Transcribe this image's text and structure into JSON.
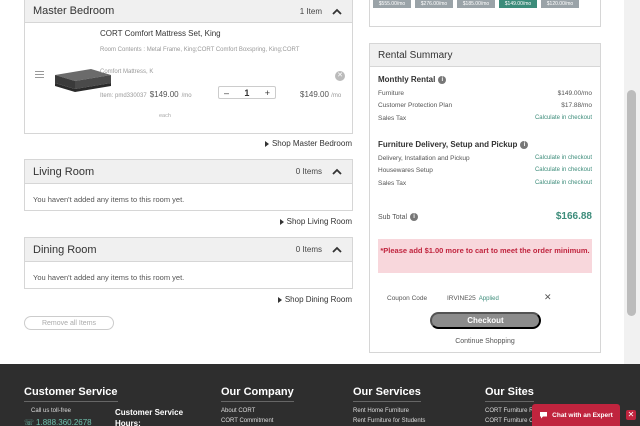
{
  "rooms": [
    {
      "title": "Master Bedroom",
      "count": "1 Item",
      "shop_link": "Shop Master Bedroom",
      "product": {
        "name": "CORT Comfort Mattress Set, King",
        "contents": "Room Contents : Metal Frame, King;CORT Comfort Boxspring, King;CORT",
        "subtitle": "Comfort Mattress, K",
        "item_id": "Item: pmd330037",
        "price": "$149.00",
        "price_unit": "/mo",
        "quantity": "1",
        "total": "$149.00",
        "total_unit": "/mo",
        "each": "each"
      }
    },
    {
      "title": "Living Room",
      "count": "0 Items",
      "empty_message": "You haven't added any items to this room yet.",
      "shop_link": "Shop Living Room"
    },
    {
      "title": "Dining Room",
      "count": "0 Items",
      "empty_message": "You haven't added any items to this room yet.",
      "shop_link": "Shop Dining Room"
    }
  ],
  "remove_all_label": "Remove all Items",
  "price_tiles": [
    "$555.00/mo",
    "$276.00/mo",
    "$185.00/mo",
    "$149.00/mo",
    "$120.00/mo"
  ],
  "summary": {
    "title": "Rental Summary",
    "monthly": {
      "title": "Monthly Rental",
      "rows": [
        {
          "label": "Furniture",
          "value": "$149.00/mo"
        },
        {
          "label": "Customer Protection Plan",
          "value": "$17.88/mo"
        },
        {
          "label": "Sales Tax",
          "value": "Calculate in checkout"
        }
      ]
    },
    "delivery": {
      "title": "Furniture Delivery, Setup and Pickup",
      "rows": [
        {
          "label": "Delivery, Installation and Pickup",
          "value": "Calculate in checkout"
        },
        {
          "label": "Housewares Setup",
          "value": "Calculate in checkout"
        },
        {
          "label": "Sales Tax",
          "value": "Calculate in checkout"
        }
      ]
    },
    "subtotal_label": "Sub Total",
    "subtotal_value": "$166.88",
    "alert": "*Please add $1.00 more to cart to meet the order minimum.",
    "coupon_label": "Coupon Code",
    "coupon_code": "IRVINE25",
    "coupon_status": "Applied",
    "checkout_label": "Checkout",
    "continue_label": "Continue Shopping"
  },
  "footer": {
    "customer_service": "Customer Service",
    "call_label": "Call us toll-free",
    "phone": "1.888.360.2678",
    "cs_hours": "Customer Service Hours:",
    "company": "Our Company",
    "company_links": [
      "About CORT",
      "CORT Commitment"
    ],
    "services": "Our Services",
    "services_links": [
      "Rent Home Furniture",
      "Rent Furniture for Students"
    ],
    "sites": "Our Sites",
    "sites_links": [
      "CORT Furniture R",
      "CORT Furniture C"
    ]
  },
  "chat_label": "Chat with an Expert",
  "colors": {
    "accent_green": "#3c8c7a",
    "alert_red": "#c0243e",
    "footer_bg": "#2e2e2e"
  }
}
